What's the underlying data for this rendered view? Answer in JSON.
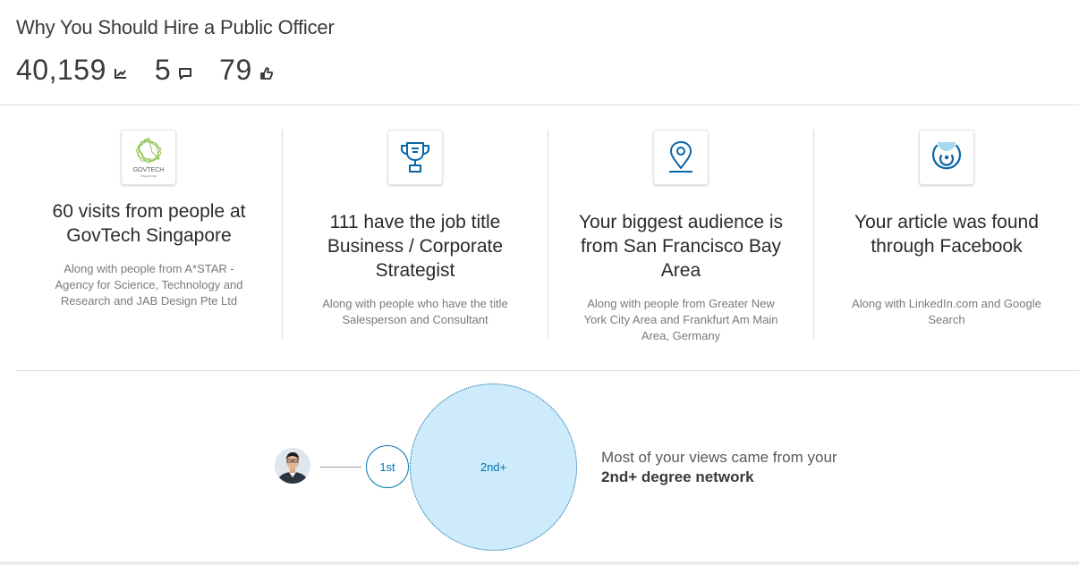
{
  "article": {
    "title": "Why You Should Hire a Public Officer"
  },
  "stats": {
    "views": "40,159",
    "comments": "5",
    "likes": "79",
    "icons": [
      "views-trend-icon",
      "comment-icon",
      "like-icon"
    ]
  },
  "highlights": [
    {
      "icon": "govtech-logo",
      "logo_text": "GOVTECH",
      "logo_subtext": "SINGAPORE",
      "headline": "60 visits from people at GovTech Singapore",
      "sub": "Along with people from A*STAR - Agency for Science, Technology and Research and JAB Design Pte Ltd"
    },
    {
      "icon": "trophy-icon",
      "headline": "111 have the job title Business / Corporate Strategist",
      "sub": "Along with people who have the title Salesperson and Consultant"
    },
    {
      "icon": "location-pin-icon",
      "headline": "Your biggest audience is from San Francisco Bay Area",
      "sub": "Along with people from Greater New York City Area and Frankfurt Am Main Area, Germany"
    },
    {
      "icon": "traffic-source-icon",
      "headline": "Your article was found through Facebook",
      "sub": "Along with LinkedIn.com and Google Search"
    }
  ],
  "network": {
    "first_label": "1st",
    "second_label": "2nd+",
    "text_prefix": "Most of your views came from your",
    "text_bold": "2nd+ degree network"
  },
  "colors": {
    "accent": "#0073b1",
    "bubble_fill": "#cdebfa",
    "icon_blue": "#0a66a8",
    "logo_green": "#7fbf3f"
  }
}
